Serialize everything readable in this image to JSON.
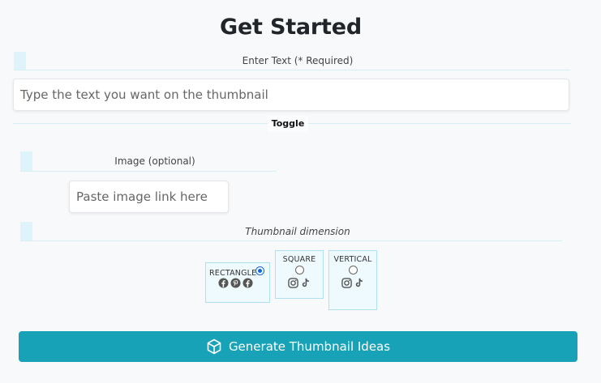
{
  "page": {
    "title": "Get Started"
  },
  "text_field": {
    "label": "Enter Text (* Required)",
    "placeholder": "Type the text you want on the thumbnail"
  },
  "toggle": {
    "label": "Toggle"
  },
  "image_field": {
    "label": "Image (optional)",
    "placeholder": "Paste image link here"
  },
  "dimension": {
    "label": "Thumbnail dimension",
    "options": [
      {
        "label": "RECTANGLE",
        "selected": true,
        "icons": [
          "facebook-icon",
          "pinterest-icon",
          "facebook-icon"
        ]
      },
      {
        "label": "SQUARE",
        "selected": false,
        "icons": [
          "instagram-icon",
          "tiktok-icon"
        ]
      },
      {
        "label": "VERTICAL",
        "selected": false,
        "icons": [
          "instagram-icon",
          "tiktok-icon"
        ]
      }
    ]
  },
  "generate_button": {
    "label": "Generate Thumbnail Ideas",
    "icon": "cube-icon"
  },
  "colors": {
    "accent": "#17a2b8",
    "radio_selected": "#0b6ad7",
    "card_border": "#aee0f0"
  }
}
